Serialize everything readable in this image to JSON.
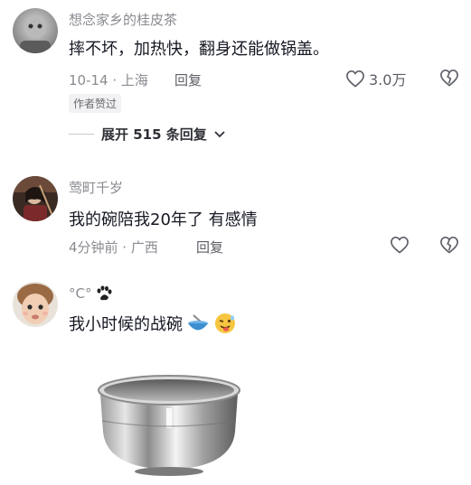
{
  "comments": [
    {
      "username": "想念家乡的桂皮茶",
      "content": "摔不坏，加热快，翻身还能做锅盖。",
      "time_location": "10-14 · 上海",
      "reply_label": "回复",
      "like_count": "3.0万",
      "badge": "作者赞过",
      "expand_label": "展开 515 条回复"
    },
    {
      "username": "莺町千岁",
      "content": "我的碗陪我20年了 有感情",
      "time_location": "4分钟前 · 广西",
      "reply_label": "回复"
    },
    {
      "username": "°C°",
      "content": "我小时候的战碗"
    }
  ],
  "colors": {
    "meta_gray": "#8a8b91",
    "text": "#161823",
    "background": "#ffffff"
  }
}
